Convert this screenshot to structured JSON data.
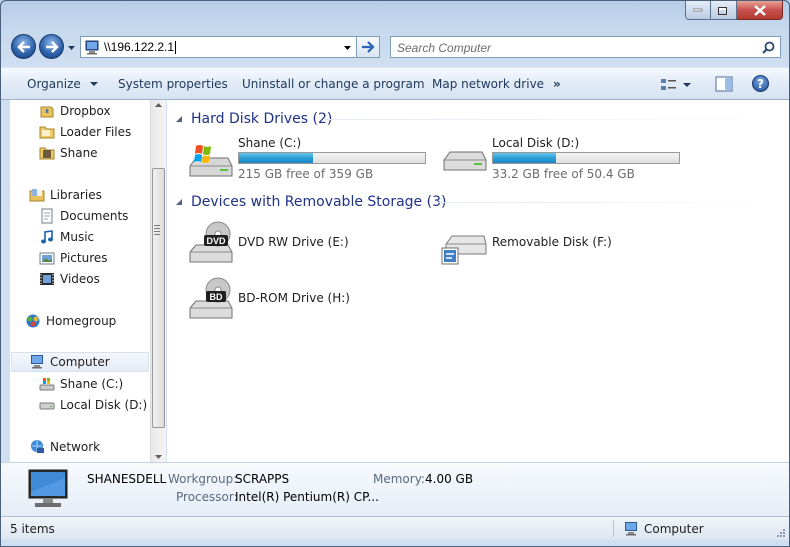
{
  "address_bar": {
    "path": "\\\\196.122.2.1"
  },
  "search": {
    "placeholder": "Search Computer"
  },
  "command_bar": {
    "organize": "Organize",
    "system_properties": "System properties",
    "uninstall": "Uninstall or change a program",
    "map_drive": "Map network drive",
    "more": "»"
  },
  "nav_pane": {
    "favorites": [
      {
        "label": "Dropbox",
        "icon": "dropbox-icon"
      },
      {
        "label": "Loader Files",
        "icon": "folder-icon"
      },
      {
        "label": "Shane",
        "icon": "user-folder-icon"
      }
    ],
    "libraries": {
      "label": "Libraries",
      "items": [
        "Documents",
        "Music",
        "Pictures",
        "Videos"
      ]
    },
    "homegroup": "Homegroup",
    "computer": {
      "label": "Computer",
      "items": [
        "Shane (C:)",
        "Local Disk (D:)"
      ]
    },
    "network": "Network"
  },
  "content": {
    "hard_disk_header": "Hard Disk Drives (2)",
    "hard_disks": [
      {
        "name": "Shane (C:)",
        "free": "215 GB free of 359 GB",
        "used_fraction": 0.4
      },
      {
        "name": "Local Disk (D:)",
        "free": "33.2 GB free of 50.4 GB",
        "used_fraction": 0.34
      }
    ],
    "removable_header": "Devices with Removable Storage (3)",
    "removable": [
      {
        "name": "DVD RW Drive (E:)",
        "badge": "DVD"
      },
      {
        "name": "Removable Disk (F:)"
      },
      {
        "name": "BD-ROM Drive (H:)",
        "badge": "BD"
      }
    ]
  },
  "details": {
    "computer_name": "SHANESDELL",
    "workgroup_label": "Workgroup:",
    "workgroup": "SCRAPPS",
    "memory_label": "Memory:",
    "memory": "4.00 GB",
    "processor_label": "Processor:",
    "processor": "Intel(R) Pentium(R) CP..."
  },
  "status_bar": {
    "items": "5 items",
    "location": "Computer"
  },
  "colors": {
    "accent": "#1e3287",
    "progress": "#2b9fd6",
    "window_frame": "#cfdef0"
  }
}
